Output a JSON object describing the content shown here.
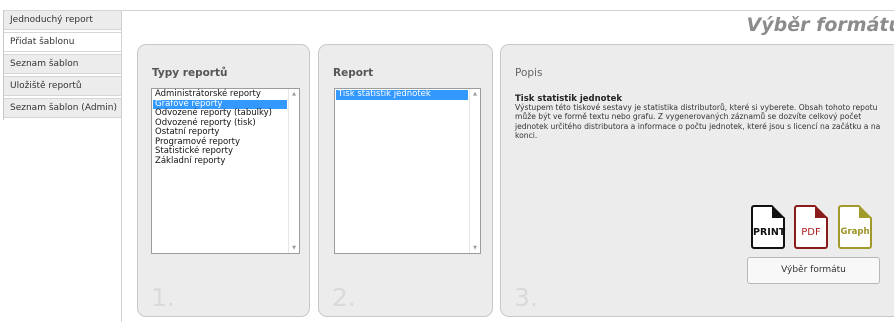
{
  "nav": {
    "items": [
      {
        "label": "Jednoduchý report"
      },
      {
        "label": "Přidat šablonu"
      },
      {
        "label": "Seznam šablon"
      },
      {
        "label": "Uložiště reportů"
      },
      {
        "label": "Seznam šablon (Admin)"
      }
    ],
    "active_index": 1
  },
  "header": {
    "title": "Výběr formátu"
  },
  "panel1": {
    "title": "Typy reportů",
    "step": "1.",
    "items": [
      "Administrátorské reporty",
      "Grafové reporty",
      "Odvozené reporty (tabulky)",
      "Odvozené reporty (tisk)",
      "Ostatní reporty",
      "Programové reporty",
      "Statistické reporty",
      "Základní reporty"
    ],
    "selected_index": 1
  },
  "panel2": {
    "title": "Report",
    "step": "2.",
    "items": [
      "Tisk statistik jednotek"
    ],
    "selected_index": 0
  },
  "panel3": {
    "title": "Popis",
    "step": "3.",
    "description_title": "Tisk statistik jednotek",
    "description_text": "Výstupem této tiskové sestavy je statistika distributorů, které si vyberete. Obsah tohoto repotu může být ve formě textu nebo grafu. Z vygenerovaných záznamů se dozvíte celkový počet jednotek určitého distributora a informace o počtu jednotek, které jsou s licencí na začátku a na konci.",
    "formats": {
      "print": "PRINT",
      "pdf": "PDF",
      "graph": "Graph"
    },
    "format_button": "Výběr formátu"
  },
  "colors": {
    "selection": "#3399ff",
    "panel_bg": "#ececec",
    "title_gray": "#8c8c8c"
  }
}
